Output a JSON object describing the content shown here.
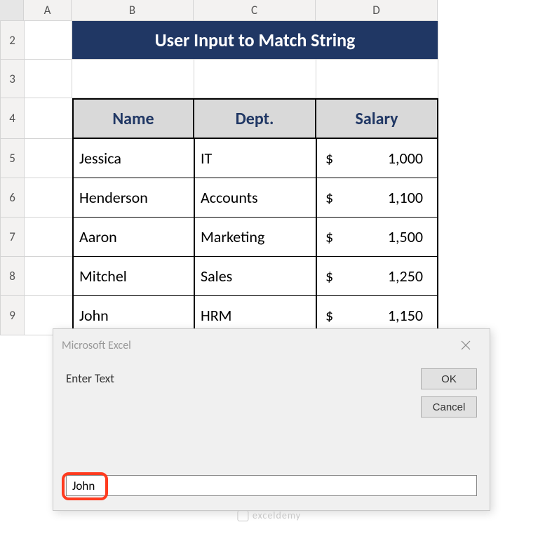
{
  "columns": [
    "A",
    "B",
    "C",
    "D"
  ],
  "row_numbers": [
    "2",
    "3",
    "4",
    "5",
    "6",
    "7",
    "8",
    "9"
  ],
  "banner": "User Input to Match String",
  "table": {
    "headers": [
      "Name",
      "Dept.",
      "Salary"
    ],
    "rows": [
      {
        "name": "Jessica",
        "dept": "IT",
        "currency": "$",
        "salary": "1,000"
      },
      {
        "name": "Henderson",
        "dept": "Accounts",
        "currency": "$",
        "salary": "1,100"
      },
      {
        "name": "Aaron",
        "dept": "Marketing",
        "currency": "$",
        "salary": "1,500"
      },
      {
        "name": "Mitchel",
        "dept": "Sales",
        "currency": "$",
        "salary": "1,250"
      },
      {
        "name": "John",
        "dept": "HRM",
        "currency": "$",
        "salary": "1,150"
      }
    ]
  },
  "dialog": {
    "title": "Microsoft Excel",
    "prompt": "Enter Text",
    "ok": "OK",
    "cancel": "Cancel",
    "input_value": "John"
  },
  "watermark": "exceldemy"
}
